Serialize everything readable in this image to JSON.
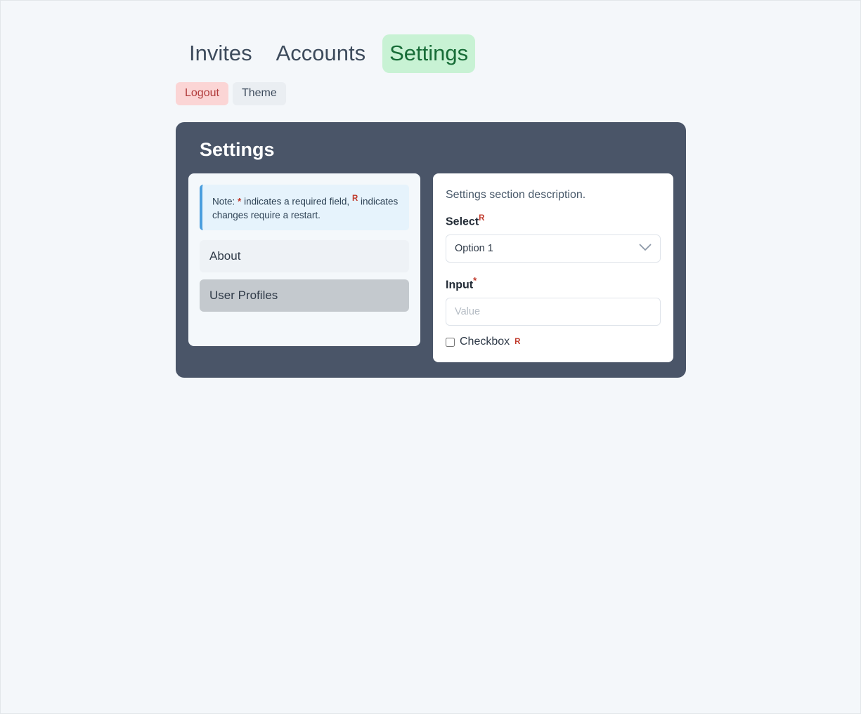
{
  "nav": {
    "tabs": [
      {
        "label": "Invites",
        "active": false
      },
      {
        "label": "Accounts",
        "active": false
      },
      {
        "label": "Settings",
        "active": true
      }
    ]
  },
  "actions": {
    "logout_label": "Logout",
    "theme_label": "Theme"
  },
  "card": {
    "title": "Settings"
  },
  "note": {
    "prefix": "Note:",
    "star": "*",
    "middle": "indicates a required field,",
    "r": "R",
    "suffix": "indicates changes require a restart."
  },
  "sidebar": {
    "items": [
      {
        "label": "About",
        "selected": false
      },
      {
        "label": "User Profiles",
        "selected": true
      }
    ]
  },
  "form": {
    "description": "Settings section description.",
    "select": {
      "label": "Select",
      "marker": "R",
      "value": "Option 1",
      "options": [
        "Option 1"
      ]
    },
    "input": {
      "label": "Input",
      "marker": "*",
      "value": "",
      "placeholder": "Value"
    },
    "checkbox": {
      "label": "Checkbox",
      "marker": "R",
      "checked": false
    }
  },
  "colors": {
    "accent_active_tab_bg": "#c8f2d4",
    "accent_active_tab_text": "#176c37",
    "logout_bg": "#fbd5d5",
    "logout_text": "#b03a3a",
    "card_bg": "#4a5568",
    "required_marker": "#c0392b",
    "note_bg": "#e6f3fc",
    "note_border": "#4a9ede",
    "page_bg": "#f4f7fa"
  }
}
